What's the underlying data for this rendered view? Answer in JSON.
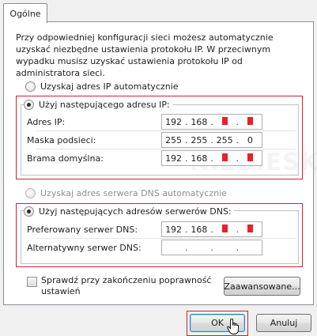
{
  "tab": {
    "label": "Ogólne"
  },
  "intro_text": "Przy odpowiedniej konfiguracji sieci możesz automatycznie uzyskać niezbędne ustawienia protokołu IP. W przeciwnym wypadku musisz uzyskać ustawienia protokołu IP od administratora sieci.",
  "ip_section": {
    "auto_label": "Uzyskaj adres IP automatycznie",
    "manual_label": "Użyj następującego adresu IP:",
    "fields": [
      {
        "label": "Adres IP:",
        "value": [
          "192",
          "168",
          "",
          ""
        ],
        "redacted": true
      },
      {
        "label": "Maska podsieci:",
        "value": [
          "255",
          "255",
          "255",
          "0"
        ],
        "redacted": false
      },
      {
        "label": "Brama domyślna:",
        "value": [
          "192",
          "168",
          "",
          ""
        ],
        "redacted": true
      }
    ]
  },
  "dns_section": {
    "auto_label": "Uzyskaj adres serwera DNS automatycznie",
    "manual_label": "Użyj następujących adresów serwerów DNS:",
    "fields": [
      {
        "label": "Preferowany serwer DNS:",
        "value": [
          "192",
          "168",
          "",
          ""
        ],
        "redacted": true
      },
      {
        "label": "Alternatywny serwer DNS:",
        "value": [
          "",
          "",
          "",
          ""
        ],
        "redacted": false
      }
    ]
  },
  "validate_checkbox": {
    "label": "Sprawdź przy zakończeniu poprawność ustawień",
    "checked": false
  },
  "buttons": {
    "advanced": "Zaawansowane...",
    "ok": "OK",
    "cancel": "Anuluj"
  },
  "colors": {
    "highlight_red": "#c9252e",
    "redaction_red": "#e8202a",
    "default_button_blue": "#3c7fb1"
  },
  "watermark_text": "NIEBIESKI.pl"
}
